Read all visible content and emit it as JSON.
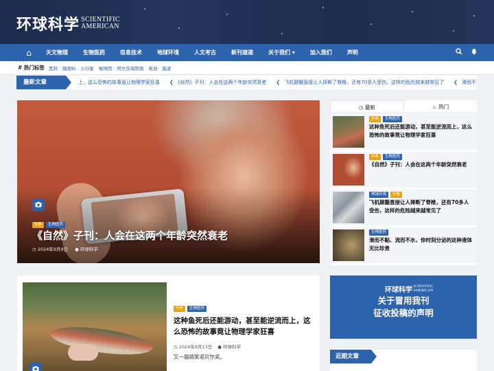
{
  "site": {
    "logo_cn": "环球科学",
    "logo_en_line1": "SCIENTIFIC",
    "logo_en_line2": "AMERICAN"
  },
  "nav": {
    "home_icon": "home-icon",
    "items": [
      "天文物理",
      "生物医药",
      "信息技术",
      "地球环境",
      "人文考古",
      "新刊速递",
      "关于我们 ▾",
      "加入我们",
      "声明"
    ],
    "search_icon": "search-icon",
    "bell_icon": "bell-icon"
  },
  "hot_tags": {
    "label": "# 热门标签",
    "tags": [
      "黑洞",
      "微塑料",
      "小行星",
      "咖啡因",
      "阿尔茨海默病",
      "电池",
      "脑波"
    ]
  },
  "ticker": {
    "label": "最新文章",
    "items": [
      "上，这么恐怖的故事竟让物理学家狂喜",
      "《自然》子刊：人会在这两个年龄突然衰老",
      "飞机颠簸直接让人摔断了脊椎，还有70多人受伤，这样的危险越来越常见了",
      "滑而不"
    ]
  },
  "featured": {
    "badges": [
      "头条",
      "生物医药"
    ],
    "title": "《自然》子刊：人会在这两个年龄突然衰老",
    "date": "2024年9月9日",
    "author": "环球科学"
  },
  "post": {
    "badges": [
      "头条",
      "生物医药"
    ],
    "title": "这种鱼死后还能游动，甚至能逆流而上，这么恐怖的故事竟让物理学家狂喜",
    "date": "2024年9月13日",
    "author": "环球科学",
    "excerpt": "又一届搞笑诺贝尔奖。"
  },
  "sidebar_tabs": {
    "tabs": [
      "最新",
      "热门"
    ],
    "items": [
      {
        "badges": [
          "头条",
          "生物医药"
        ],
        "title": "这种鱼死后还能游动，甚至能逆流而上，这么恐怖的故事竟让物理学家狂喜"
      },
      {
        "badges": [
          "头条",
          "生物医药"
        ],
        "title": "《自然》子刊：人会在这两个年龄突然衰老"
      },
      {
        "badges": [
          "地球环境",
          "头条"
        ],
        "title": "飞机颠簸直接让人摔断了脊椎，还有70多人受伤，这样的危险越来越常见了"
      },
      {
        "badges": [
          "生物医药"
        ],
        "title": "滑而不黏、流而不水，你时刻分泌的这种液体无比珍贵"
      }
    ]
  },
  "ad": {
    "logo_cn": "环球科学",
    "logo_en_line1": "SCIENTIFIC",
    "logo_en_line2": "AMERICAN",
    "line1": "关于冒用我刊",
    "line2": "征收投稿的声明"
  },
  "recent": {
    "label": "近期文章"
  },
  "colors": {
    "accent": "#2d62ac",
    "badge_orange": "#e8a317",
    "header_bg": "#1b2a4a"
  }
}
